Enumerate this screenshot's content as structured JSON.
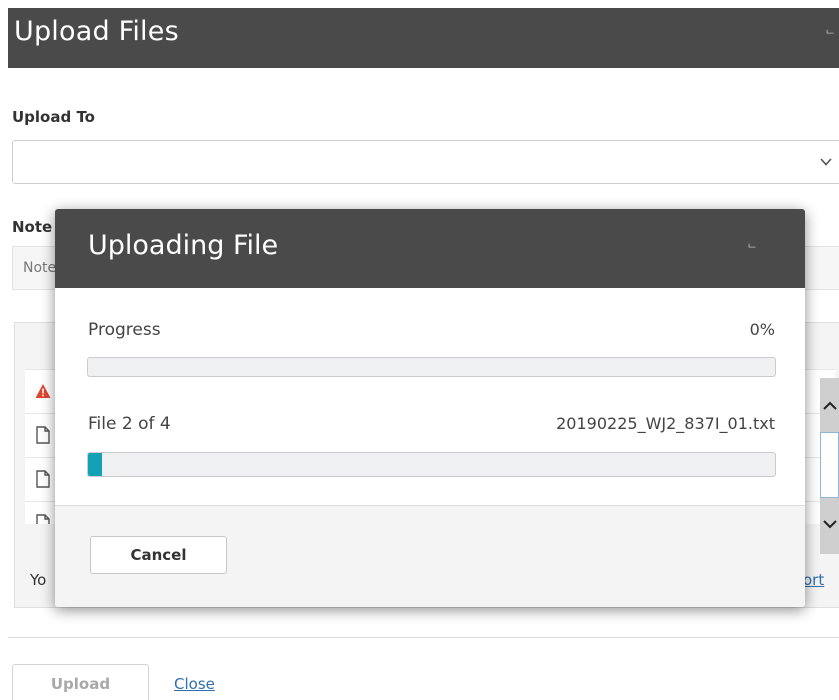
{
  "window": {
    "title": "Upload Files",
    "maximize_glyph": "ᄂ"
  },
  "form": {
    "upload_to_label": "Upload To",
    "upload_to_value": "",
    "note_label": "Note",
    "note_placeholder": "Note"
  },
  "file_list": {
    "rows": [
      {
        "icon": "warning-icon"
      },
      {
        "icon": "document-icon"
      },
      {
        "icon": "document-icon"
      },
      {
        "icon": "document-icon"
      }
    ],
    "footer_text": "Yo",
    "footer_link": "ort"
  },
  "actions": {
    "upload_label": "Upload",
    "close_label": "Close"
  },
  "modal": {
    "title": "Uploading File",
    "maximize_glyph": "ᄂ",
    "progress_label": "Progress",
    "progress_percent_text": "0%",
    "progress_fraction": 0,
    "file_count_text": "File 2 of 4",
    "file_name": "20190225_WJ2_837I_01.txt",
    "file_progress_fraction": 0.02,
    "cancel_label": "Cancel"
  },
  "colors": {
    "header_bg": "#4a4a4a",
    "progress_fill": "#14a0b5",
    "link": "#2f6fae",
    "warning": "#e0452f"
  }
}
